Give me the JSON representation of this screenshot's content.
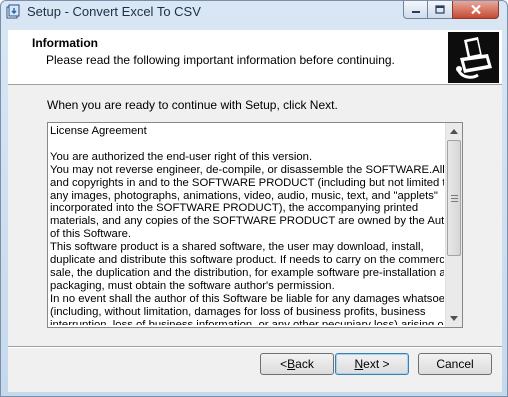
{
  "window": {
    "title": "Setup - Convert Excel To CSV"
  },
  "header": {
    "title": "Information",
    "subtitle": "Please read the following important information before continuing."
  },
  "intro_text": "When you are ready to continue with Setup, click Next.",
  "license_text": "License Agreement\n\nYou are authorized the end-user right of this version.\nYou may not reverse engineer, de-compile, or disassemble the SOFTWARE.All title\nand copyrights in and to the SOFTWARE PRODUCT (including but not limited to\nany images, photographs, animations, video, audio, music, text, and \"applets\"\nincorporated into the SOFTWARE PRODUCT), the accompanying printed\nmaterials, and any copies of the SOFTWARE PRODUCT are owned by the Author\nof this Software.\nThis software product is a shared software, the user may download, install,\nduplicate and distribute this software product. If needs to carry on the commercial\nsale, the duplication and the distribution, for example software pre-installation and\npackaging, must obtain the software author's permission.\nIn no event shall the author of this Software be liable for any damages whatsoever\n(including, without limitation, damages for loss of business profits, business\ninterruption, loss of business information, or any other pecuniary loss) arising out of",
  "buttons": {
    "back_prefix": "< ",
    "back_key": "B",
    "back_rest": "ack",
    "next_prefix": "",
    "next_key": "N",
    "next_rest": "ext >",
    "cancel": "Cancel"
  },
  "icons": {
    "app": "setup-app-icon",
    "header_logo": "installer-box-icon",
    "minimize": "minimize-icon",
    "maximize": "maximize-icon",
    "close": "close-icon"
  },
  "colors": {
    "accent_border": "#3c7fb1",
    "close_button": "#c44a33"
  }
}
